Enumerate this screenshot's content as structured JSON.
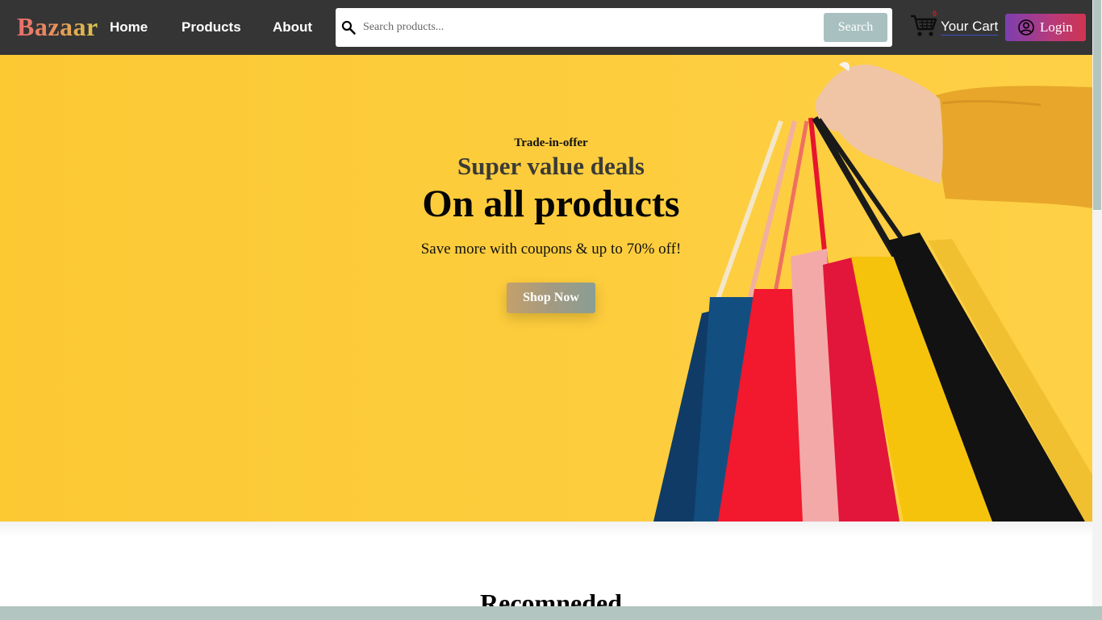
{
  "brand": {
    "name": "Bazaar"
  },
  "nav": {
    "links": [
      {
        "label": "Home"
      },
      {
        "label": "Products"
      },
      {
        "label": "About"
      }
    ]
  },
  "search": {
    "placeholder": "Search products...",
    "value": "",
    "button_label": "Search"
  },
  "cart": {
    "count": "0",
    "label": "Your Cart"
  },
  "login": {
    "label": "Login"
  },
  "hero": {
    "eyebrow": "Trade-in-offer",
    "subheading": "Super value deals",
    "heading": "On all products",
    "description": "Save more with coupons & up to 70% off!",
    "cta_label": "Shop Now"
  },
  "recommended": {
    "title": "Recomneded"
  },
  "colors": {
    "navbar_bg": "#353535",
    "hero_bg": "#fccb37",
    "search_button": "#a9c0c0",
    "cart_badge": "#e01818",
    "scrollbar": "#b3c5c0"
  }
}
